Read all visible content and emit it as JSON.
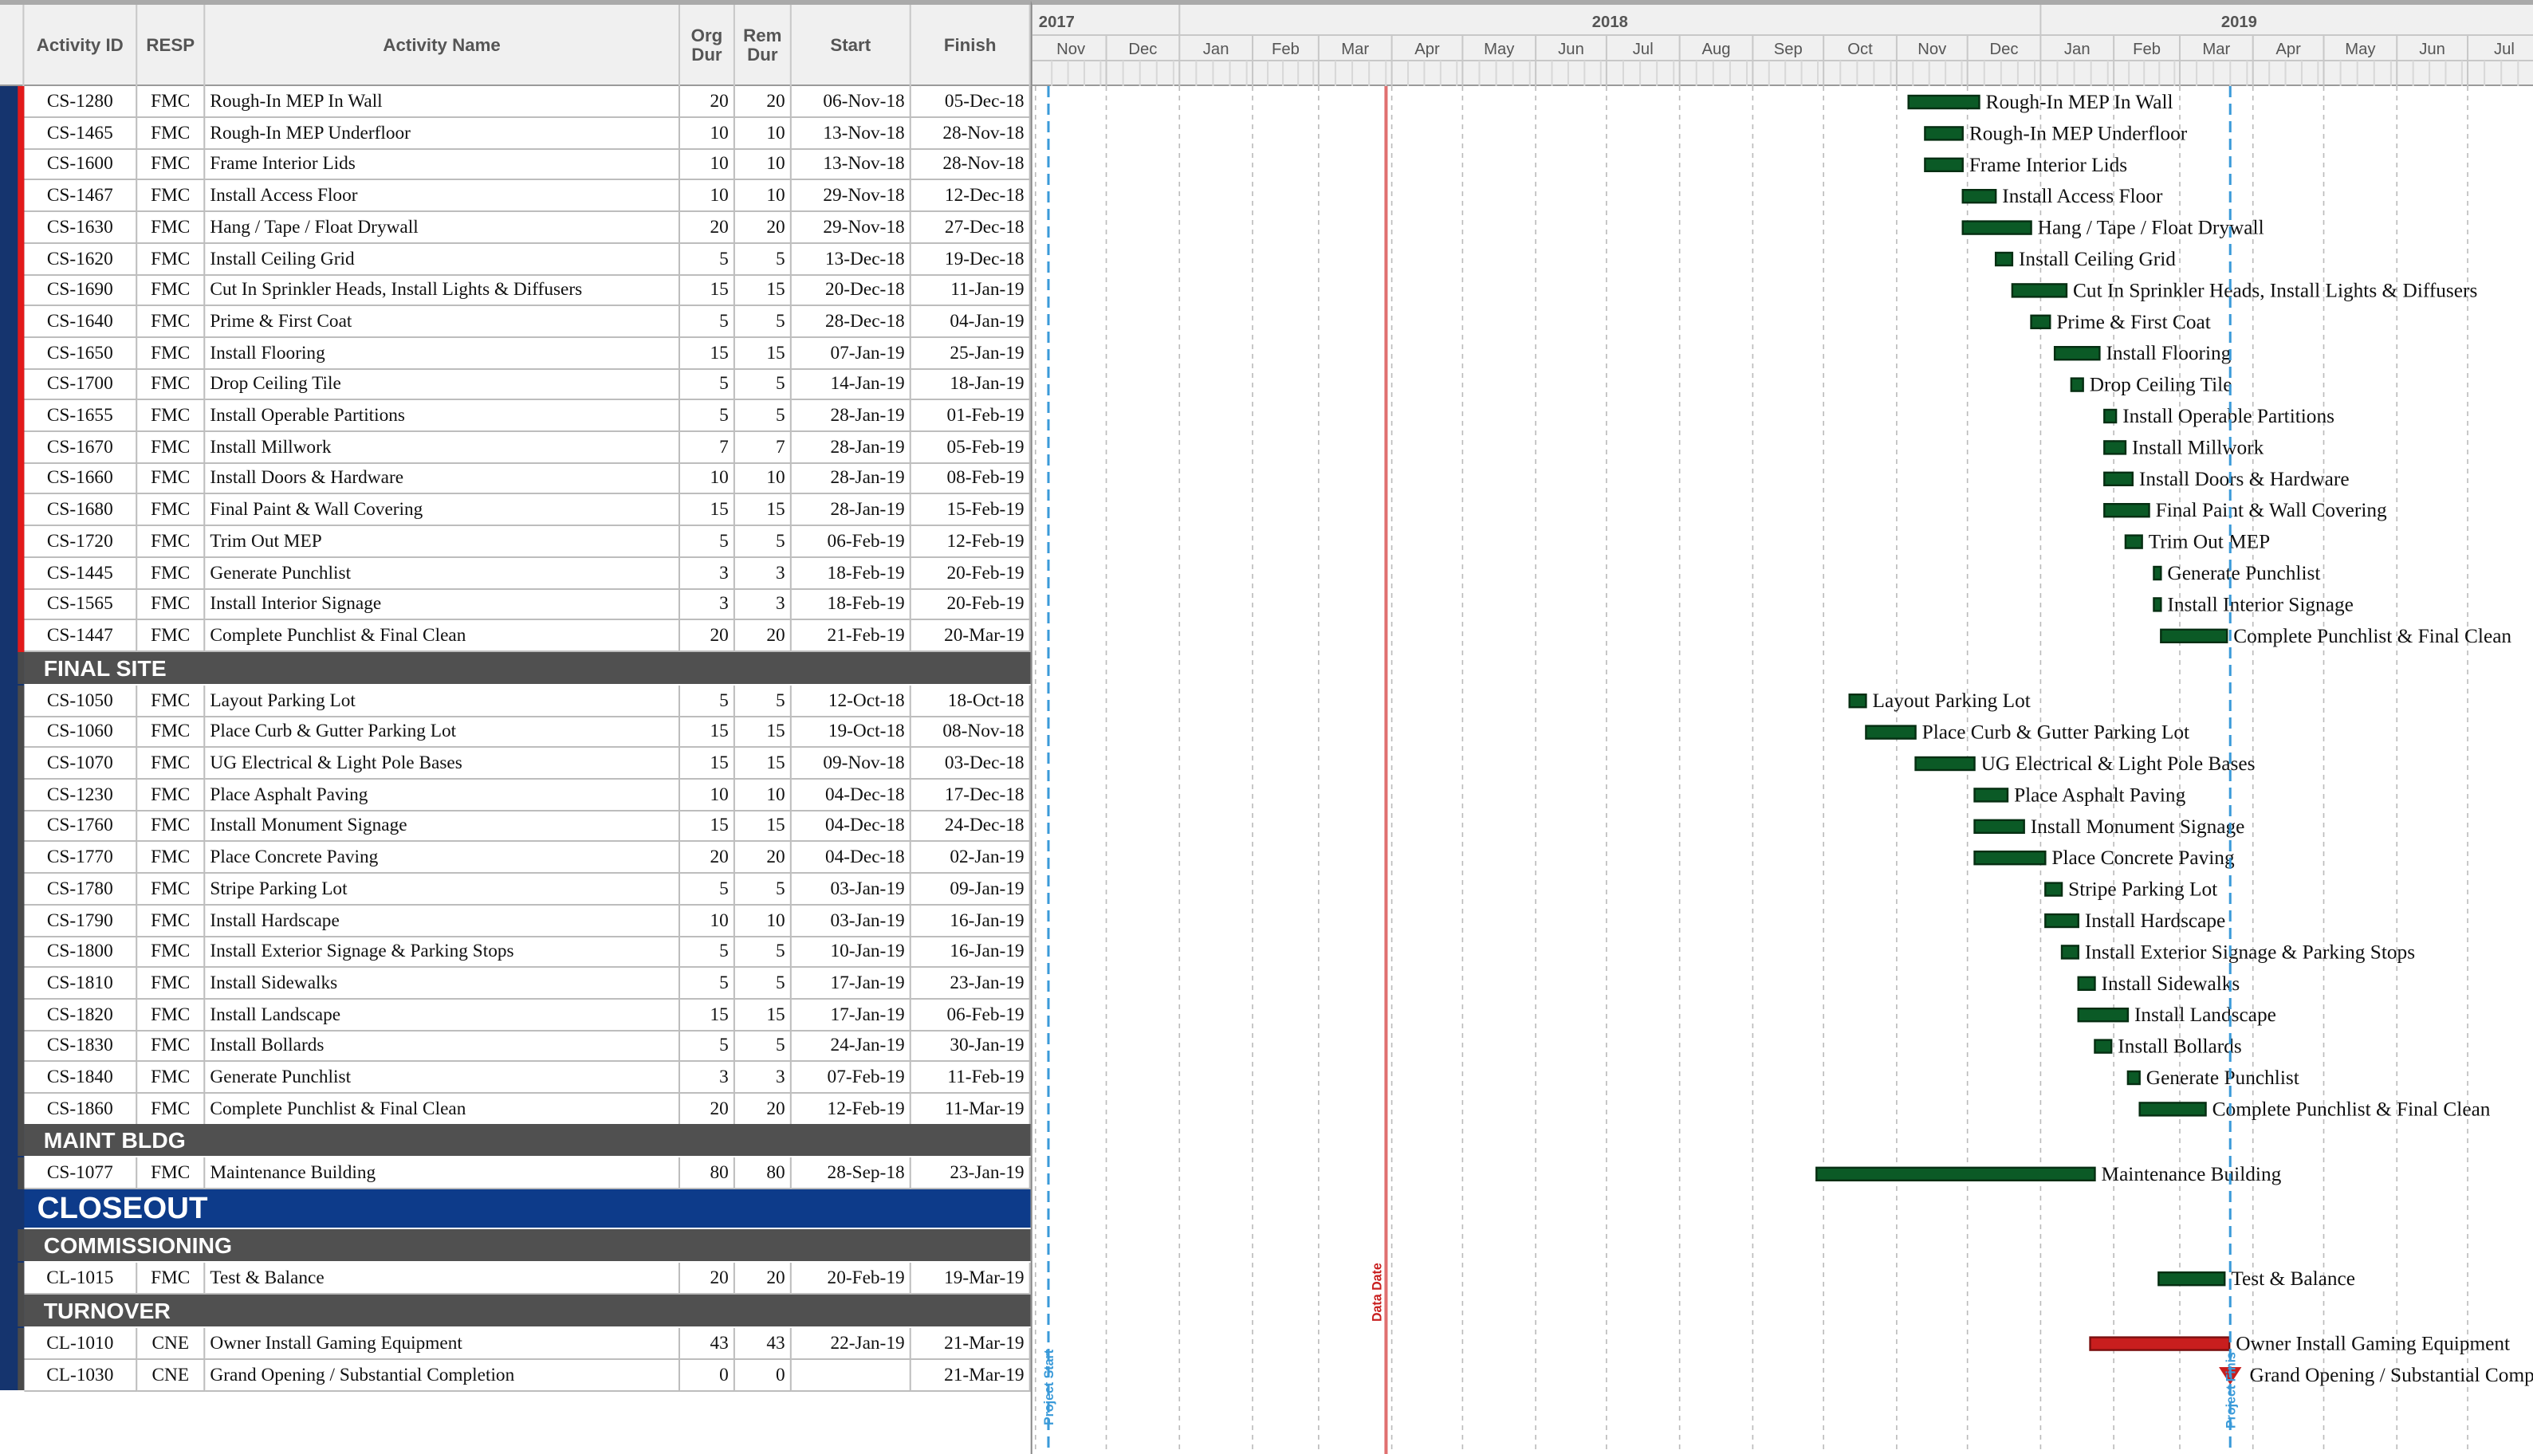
{
  "columns": {
    "activity_id": "Activity ID",
    "resp": "RESP",
    "activity_name": "Activity Name",
    "org_dur_1": "Org",
    "org_dur_2": "Dur",
    "rem_dur_1": "Rem",
    "rem_dur_2": "Dur",
    "start": "Start",
    "finish": "Finish"
  },
  "timescale": {
    "years": [
      "2017",
      "2018",
      "2019"
    ],
    "months": [
      "Nov",
      "Dec",
      "Jan",
      "Feb",
      "Mar",
      "Apr",
      "May",
      "Jun",
      "Jul",
      "Aug",
      "Sep",
      "Oct",
      "Nov",
      "Dec",
      "Jan",
      "Feb",
      "Mar",
      "Apr",
      "May",
      "Jun",
      "Jul"
    ]
  },
  "markers": {
    "project_start": "Project Start",
    "data_date": "Data Date",
    "project_finish": "Project Finis"
  },
  "colors": {
    "bar_normal": "#0b5a26",
    "bar_critical": "#c81e1e",
    "band_group": "#505050",
    "band_section": "#0d3b8a",
    "data_date_line": "#e07070",
    "project_line": "#3a9ad9"
  },
  "groups": [
    {
      "title": "",
      "activities": [
        {
          "id": "CS-1280",
          "resp": "FMC",
          "name": "Rough-In MEP In Wall",
          "org": "20",
          "rem": "20",
          "start": "06-Nov-18",
          "finish": "05-Dec-18"
        },
        {
          "id": "CS-1465",
          "resp": "FMC",
          "name": "Rough-In MEP Underfloor",
          "org": "10",
          "rem": "10",
          "start": "13-Nov-18",
          "finish": "28-Nov-18"
        },
        {
          "id": "CS-1600",
          "resp": "FMC",
          "name": "Frame Interior Lids",
          "org": "10",
          "rem": "10",
          "start": "13-Nov-18",
          "finish": "28-Nov-18"
        },
        {
          "id": "CS-1467",
          "resp": "FMC",
          "name": "Install Access Floor",
          "org": "10",
          "rem": "10",
          "start": "29-Nov-18",
          "finish": "12-Dec-18"
        },
        {
          "id": "CS-1630",
          "resp": "FMC",
          "name": "Hang / Tape / Float Drywall",
          "org": "20",
          "rem": "20",
          "start": "29-Nov-18",
          "finish": "27-Dec-18"
        },
        {
          "id": "CS-1620",
          "resp": "FMC",
          "name": "Install Ceiling Grid",
          "org": "5",
          "rem": "5",
          "start": "13-Dec-18",
          "finish": "19-Dec-18"
        },
        {
          "id": "CS-1690",
          "resp": "FMC",
          "name": "Cut In Sprinkler Heads, Install Lights & Diffusers",
          "org": "15",
          "rem": "15",
          "start": "20-Dec-18",
          "finish": "11-Jan-19"
        },
        {
          "id": "CS-1640",
          "resp": "FMC",
          "name": "Prime & First Coat",
          "org": "5",
          "rem": "5",
          "start": "28-Dec-18",
          "finish": "04-Jan-19"
        },
        {
          "id": "CS-1650",
          "resp": "FMC",
          "name": "Install Flooring",
          "org": "15",
          "rem": "15",
          "start": "07-Jan-19",
          "finish": "25-Jan-19"
        },
        {
          "id": "CS-1700",
          "resp": "FMC",
          "name": "Drop Ceiling Tile",
          "org": "5",
          "rem": "5",
          "start": "14-Jan-19",
          "finish": "18-Jan-19"
        },
        {
          "id": "CS-1655",
          "resp": "FMC",
          "name": "Install Operable Partitions",
          "org": "5",
          "rem": "5",
          "start": "28-Jan-19",
          "finish": "01-Feb-19"
        },
        {
          "id": "CS-1670",
          "resp": "FMC",
          "name": "Install Millwork",
          "org": "7",
          "rem": "7",
          "start": "28-Jan-19",
          "finish": "05-Feb-19"
        },
        {
          "id": "CS-1660",
          "resp": "FMC",
          "name": "Install Doors & Hardware",
          "org": "10",
          "rem": "10",
          "start": "28-Jan-19",
          "finish": "08-Feb-19"
        },
        {
          "id": "CS-1680",
          "resp": "FMC",
          "name": "Final Paint & Wall Covering",
          "org": "15",
          "rem": "15",
          "start": "28-Jan-19",
          "finish": "15-Feb-19"
        },
        {
          "id": "CS-1720",
          "resp": "FMC",
          "name": "Trim Out MEP",
          "org": "5",
          "rem": "5",
          "start": "06-Feb-19",
          "finish": "12-Feb-19"
        },
        {
          "id": "CS-1445",
          "resp": "FMC",
          "name": "Generate Punchlist",
          "org": "3",
          "rem": "3",
          "start": "18-Feb-19",
          "finish": "20-Feb-19"
        },
        {
          "id": "CS-1565",
          "resp": "FMC",
          "name": "Install Interior Signage",
          "org": "3",
          "rem": "3",
          "start": "18-Feb-19",
          "finish": "20-Feb-19"
        },
        {
          "id": "CS-1447",
          "resp": "FMC",
          "name": "Complete Punchlist & Final Clean",
          "org": "20",
          "rem": "20",
          "start": "21-Feb-19",
          "finish": "20-Mar-19"
        }
      ]
    },
    {
      "title": "FINAL SITE",
      "activities": [
        {
          "id": "CS-1050",
          "resp": "FMC",
          "name": "Layout Parking Lot",
          "org": "5",
          "rem": "5",
          "start": "12-Oct-18",
          "finish": "18-Oct-18"
        },
        {
          "id": "CS-1060",
          "resp": "FMC",
          "name": "Place Curb & Gutter Parking Lot",
          "org": "15",
          "rem": "15",
          "start": "19-Oct-18",
          "finish": "08-Nov-18"
        },
        {
          "id": "CS-1070",
          "resp": "FMC",
          "name": "UG Electrical & Light Pole Bases",
          "org": "15",
          "rem": "15",
          "start": "09-Nov-18",
          "finish": "03-Dec-18"
        },
        {
          "id": "CS-1230",
          "resp": "FMC",
          "name": "Place Asphalt Paving",
          "org": "10",
          "rem": "10",
          "start": "04-Dec-18",
          "finish": "17-Dec-18"
        },
        {
          "id": "CS-1760",
          "resp": "FMC",
          "name": "Install Monument Signage",
          "org": "15",
          "rem": "15",
          "start": "04-Dec-18",
          "finish": "24-Dec-18"
        },
        {
          "id": "CS-1770",
          "resp": "FMC",
          "name": "Place Concrete Paving",
          "org": "20",
          "rem": "20",
          "start": "04-Dec-18",
          "finish": "02-Jan-19"
        },
        {
          "id": "CS-1780",
          "resp": "FMC",
          "name": "Stripe Parking Lot",
          "org": "5",
          "rem": "5",
          "start": "03-Jan-19",
          "finish": "09-Jan-19"
        },
        {
          "id": "CS-1790",
          "resp": "FMC",
          "name": "Install Hardscape",
          "org": "10",
          "rem": "10",
          "start": "03-Jan-19",
          "finish": "16-Jan-19"
        },
        {
          "id": "CS-1800",
          "resp": "FMC",
          "name": "Install Exterior Signage & Parking Stops",
          "org": "5",
          "rem": "5",
          "start": "10-Jan-19",
          "finish": "16-Jan-19"
        },
        {
          "id": "CS-1810",
          "resp": "FMC",
          "name": "Install Sidewalks",
          "org": "5",
          "rem": "5",
          "start": "17-Jan-19",
          "finish": "23-Jan-19"
        },
        {
          "id": "CS-1820",
          "resp": "FMC",
          "name": "Install Landscape",
          "org": "15",
          "rem": "15",
          "start": "17-Jan-19",
          "finish": "06-Feb-19"
        },
        {
          "id": "CS-1830",
          "resp": "FMC",
          "name": "Install Bollards",
          "org": "5",
          "rem": "5",
          "start": "24-Jan-19",
          "finish": "30-Jan-19"
        },
        {
          "id": "CS-1840",
          "resp": "FMC",
          "name": "Generate Punchlist",
          "org": "3",
          "rem": "3",
          "start": "07-Feb-19",
          "finish": "11-Feb-19"
        },
        {
          "id": "CS-1860",
          "resp": "FMC",
          "name": "Complete Punchlist & Final Clean",
          "org": "20",
          "rem": "20",
          "start": "12-Feb-19",
          "finish": "11-Mar-19"
        }
      ]
    },
    {
      "title": "MAINT BLDG",
      "activities": [
        {
          "id": "CS-1077",
          "resp": "FMC",
          "name": "Maintenance Building",
          "org": "80",
          "rem": "80",
          "start": "28-Sep-18",
          "finish": "23-Jan-19"
        }
      ]
    },
    {
      "section": "CLOSEOUT",
      "title": "COMMISSIONING",
      "activities": [
        {
          "id": "CL-1015",
          "resp": "FMC",
          "name": "Test & Balance",
          "org": "20",
          "rem": "20",
          "start": "20-Feb-19",
          "finish": "19-Mar-19"
        }
      ]
    },
    {
      "title": "TURNOVER",
      "activities": [
        {
          "id": "CL-1010",
          "resp": "CNE",
          "name": "Owner Install Gaming Equipment",
          "org": "43",
          "rem": "43",
          "start": "22-Jan-19",
          "finish": "21-Mar-19",
          "critical": true
        },
        {
          "id": "CL-1030",
          "resp": "CNE",
          "name": "Grand Opening / Substantial Completion",
          "org": "0",
          "rem": "0",
          "start": "",
          "finish": "21-Mar-19",
          "milestone": true
        }
      ]
    }
  ]
}
